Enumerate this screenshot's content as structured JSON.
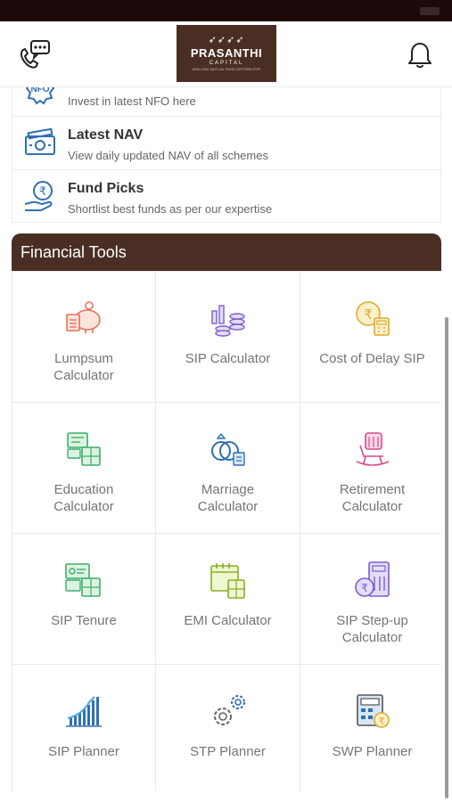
{
  "header": {
    "logo": {
      "brand": "PRASANTHI",
      "sub": "CAPITAL",
      "tagline": "ARN-0000 MUTUAL FUND DISTRIBUTOR"
    },
    "icons": {
      "support": "phone-chat-icon",
      "notifications": "bell-icon"
    }
  },
  "investment_menu": [
    {
      "title": "",
      "description": "Invest in latest NFO here",
      "icon": "nfo-icon"
    },
    {
      "title": "Latest NAV",
      "description": "View daily updated NAV of all schemes",
      "icon": "money-icon"
    },
    {
      "title": "Fund Picks",
      "description": "Shortlist best funds as per our expertise",
      "icon": "hand-rupee-icon"
    }
  ],
  "tools_section": {
    "title": "Financial Tools",
    "tools": [
      {
        "label": "Lumpsum\nCalculator",
        "icon": "piggy-bank-calculator-icon"
      },
      {
        "label": "SIP Calculator",
        "icon": "coins-chart-icon"
      },
      {
        "label": "Cost of Delay SIP",
        "icon": "rupee-coin-calculator-icon"
      },
      {
        "label": "Education\nCalculator",
        "icon": "education-calculator-icon"
      },
      {
        "label": "Marriage\nCalculator",
        "icon": "rings-calculator-icon"
      },
      {
        "label": "Retirement\nCalculator",
        "icon": "rocking-chair-icon"
      },
      {
        "label": "SIP Tenure",
        "icon": "tenure-calculator-icon"
      },
      {
        "label": "EMI Calculator",
        "icon": "calendar-calculator-icon"
      },
      {
        "label": "SIP Step-up\nCalculator",
        "icon": "stepup-calculator-icon"
      },
      {
        "label": "SIP Planner",
        "icon": "growth-chart-icon"
      },
      {
        "label": "STP Planner",
        "icon": "gears-icon"
      },
      {
        "label": "SWP Planner",
        "icon": "calculator-rupee-icon"
      }
    ]
  },
  "colors": {
    "brand": "#4a2e24",
    "status_bar": "#1c0a0a",
    "icon_blue": "#2f6fb3",
    "label": "#757575"
  }
}
